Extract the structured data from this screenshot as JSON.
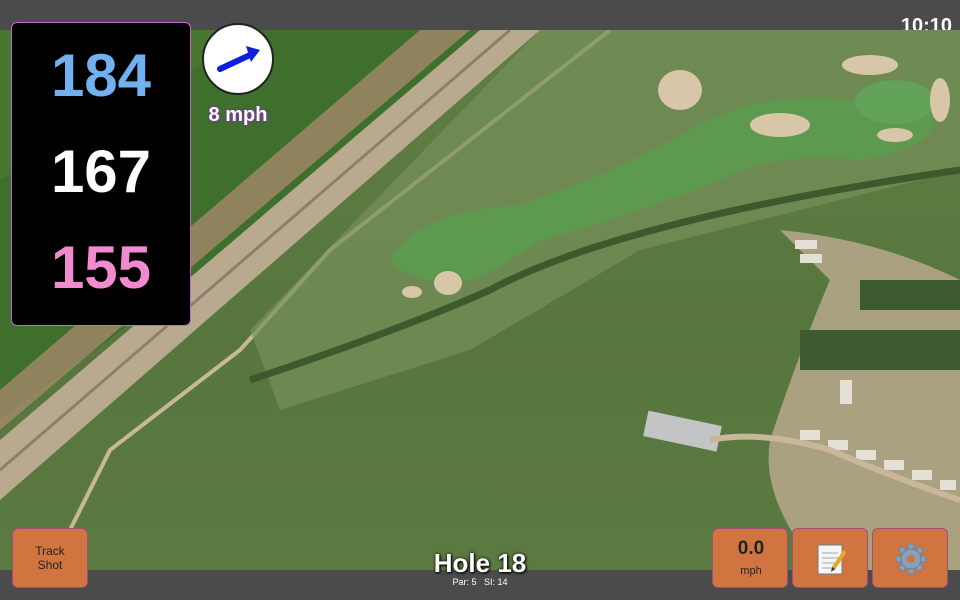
{
  "status": {
    "time": "10:10"
  },
  "distances": {
    "back": "184",
    "middle": "167",
    "front": "155"
  },
  "wind": {
    "speed_label": "8 mph",
    "icon": "wind-arrow-icon"
  },
  "buttons": {
    "track_shot": "Track\nShot",
    "speed_value": "0.0",
    "speed_unit": "mph",
    "notes_icon": "notepad-icon",
    "settings_icon": "gear-icon"
  },
  "hole": {
    "title": "Hole 18",
    "par": "Par: 5",
    "si": "SI: 14"
  },
  "colors": {
    "back": "#72b1f0",
    "middle": "#ffffff",
    "front": "#f28ad0",
    "button": "#d07540"
  }
}
